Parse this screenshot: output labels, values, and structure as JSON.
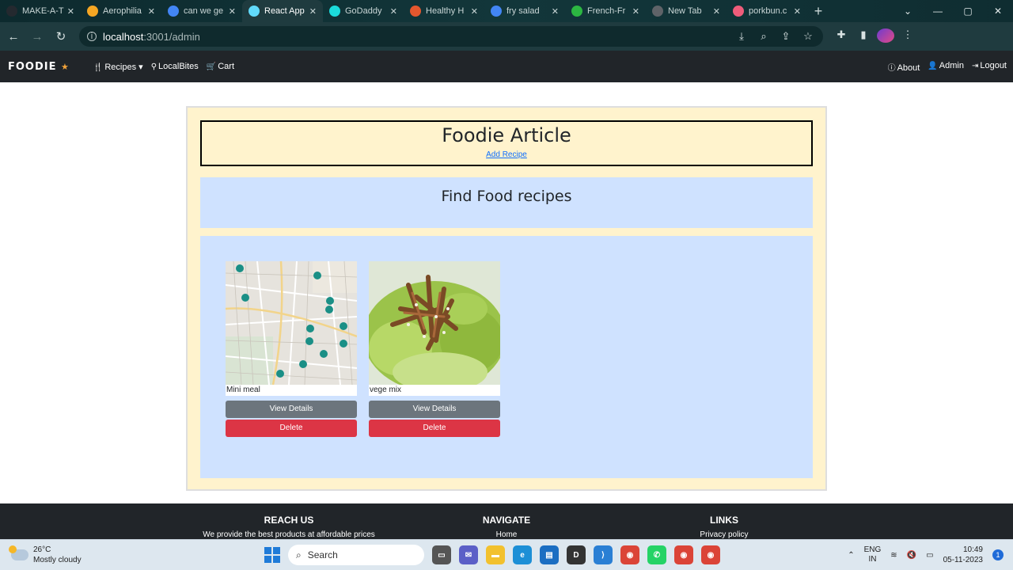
{
  "browser": {
    "tabs": [
      {
        "title": "MAKE-A-T",
        "fav_color": "#24292f"
      },
      {
        "title": "Aerophilia",
        "fav_color": "#f5a623"
      },
      {
        "title": "can we ge",
        "fav_color": "#4285f4"
      },
      {
        "title": "React App",
        "fav_color": "#61dafb"
      },
      {
        "title": "GoDaddy",
        "fav_color": "#1bdbdb"
      },
      {
        "title": "Healthy H",
        "fav_color": "#e4572e"
      },
      {
        "title": "fry salad",
        "fav_color": "#4285f4"
      },
      {
        "title": "French-Fr",
        "fav_color": "#2cb742"
      },
      {
        "title": "New Tab",
        "fav_color": "#5f6368"
      },
      {
        "title": "porkbun.c",
        "fav_color": "#ef5c7a"
      }
    ],
    "active_tab": 3,
    "url_host": "localhost",
    "url_path": ":3001/admin"
  },
  "navbar": {
    "brand": "FOODIE",
    "recipes": "Recipes",
    "localbites": "LocalBites",
    "cart": "Cart",
    "about": "About",
    "admin": "Admin",
    "logout": "Logout"
  },
  "main": {
    "title": "Foodie Article",
    "add_recipe": "Add Recipe",
    "find_heading": "Find Food recipes",
    "cards": [
      {
        "name": "Mini meal",
        "view_label": "View Details",
        "delete_label": "Delete"
      },
      {
        "name": "vege mix",
        "view_label": "View Details",
        "delete_label": "Delete"
      }
    ]
  },
  "footer": {
    "reach_title": "REACH US",
    "reach_text": "We provide the best products at affordable prices",
    "navigate_title": "NAVIGATE",
    "navigate_first": "Home",
    "links_title": "LINKS",
    "links_first": "Privacy policy"
  },
  "taskbar": {
    "temperature": "26°C",
    "weather": "Mostly cloudy",
    "search_placeholder": "Search",
    "lang_line1": "ENG",
    "lang_line2": "IN",
    "time": "10:49",
    "date": "05-11-2023",
    "notification_count": "1"
  },
  "colors": {
    "navbar_bg": "#212529",
    "outer_bg": "#fff3cd",
    "panel_bg": "#cfe2ff",
    "view_button": "#6c757d",
    "delete_button": "#dc3545"
  }
}
